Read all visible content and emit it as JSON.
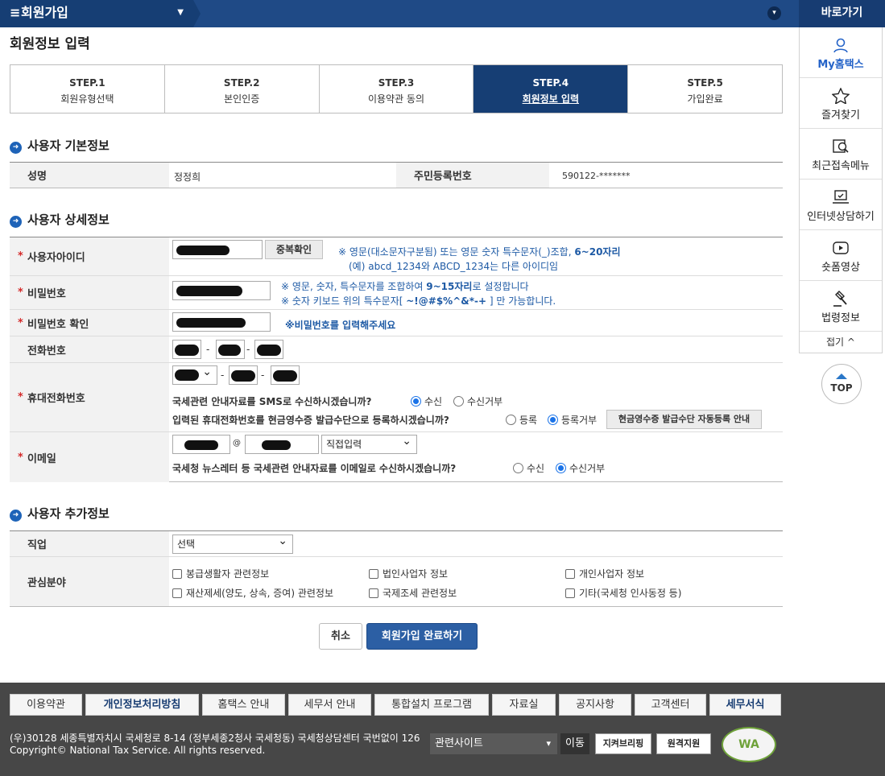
{
  "header": {
    "breadcrumb": "회원가입",
    "quick_title": "바로가기"
  },
  "sidebar": {
    "items": [
      {
        "label": "My홈택스",
        "icon": "user-icon"
      },
      {
        "label": "즐겨찾기",
        "icon": "star-icon"
      },
      {
        "label": "최근접속메뉴",
        "icon": "recent-icon"
      },
      {
        "label": "인터넷상담하기",
        "icon": "chat-icon"
      },
      {
        "label": "숏폼영상",
        "icon": "play-icon"
      },
      {
        "label": "법령정보",
        "icon": "gavel-icon"
      }
    ],
    "fold": "접기 ^",
    "top": "TOP"
  },
  "page_title": "회원정보 입력",
  "steps": [
    {
      "num": "STEP.1",
      "label": "회원유형선택"
    },
    {
      "num": "STEP.2",
      "label": "본인인증"
    },
    {
      "num": "STEP.3",
      "label": "이용약관 동의"
    },
    {
      "num": "STEP.4",
      "label": "회원정보 입력",
      "active": true
    },
    {
      "num": "STEP.5",
      "label": "가입완료"
    }
  ],
  "basic": {
    "title": "사용자 기본정보",
    "name_label": "성명",
    "name_value": "정정희",
    "rrn_label": "주민등록번호",
    "rrn_value": "590122-*******"
  },
  "detail": {
    "title": "사용자 상세정보",
    "id_label": "사용자아이디",
    "dup_btn": "중복확인",
    "id_note1": "※ 영문(대소문자구분됨) 또는 영문 숫자 특수문자(_)조합, ",
    "id_note1b": "6~20자리",
    "id_note2": "(예) abcd_1234와  ABCD_1234는 다른 아이디임",
    "pw_label": "비밀번호",
    "pw_note1": "※ 영문, 숫자, 특수문자를 조합하여 ",
    "pw_note1b": "9~15자리",
    "pw_note1c": "로 설정합니다",
    "pw_note2": "※ 숫자 키보드 위의 특수문자[ ",
    "pw_note2b": "~!@#$%^&*-+",
    "pw_note2c": " ] 만 가능합니다.",
    "pwc_label": "비밀번호 확인",
    "pwc_note": "※비밀번호를 입력해주세요",
    "tel_label": "전화번호",
    "mobile_label": "휴대전화번호",
    "sms_q": "국세관련 안내자료를 SMS로 수신하시겠습니까?",
    "sms_yes": "수신",
    "sms_no": "수신거부",
    "cash_q": "입력된 휴대전화번호를 현금영수증 발급수단으로 등록하시겠습니까?",
    "cash_yes": "등록",
    "cash_no": "등록거부",
    "cash_btn": "현금영수증 발급수단 자동등록 안내",
    "email_label": "이메일",
    "email_at": "@",
    "email_select": "직접입력",
    "news_q": "국세청 뉴스레터 등 국세관련 안내자료를 이메일로 수신하시겠습니까?",
    "news_yes": "수신",
    "news_no": "수신거부"
  },
  "extra": {
    "title": "사용자 추가정보",
    "job_label": "직업",
    "job_select": "선택",
    "interest_label": "관심분야",
    "interests": [
      "봉급생활자 관련정보",
      "법인사업자 정보",
      "개인사업자 정보",
      "재산제세(양도, 상속, 증여) 관련정보",
      "국제조세 관련정보",
      "기타(국세청 인사동정 등)"
    ]
  },
  "actions": {
    "cancel": "취소",
    "submit": "회원가입 완료하기"
  },
  "footer": {
    "nav": [
      "이용약관",
      "개인정보처리방침",
      "홈택스 안내",
      "세무서 안내",
      "통합설치 프로그램",
      "자료실",
      "공지사항",
      "고객센터",
      "세무서식"
    ],
    "address": "(우)30128 세종특별자치시 국세청로 8-14 (정부세종2청사 국세청동) 국세청상담센터 국번없이 126",
    "copyright": "Copyright© National Tax Service. All rights reserved.",
    "related": "관련사이트",
    "go": "이동",
    "btn1": "지켜브리핑",
    "btn2": "원격지원",
    "wa": "WA"
  }
}
